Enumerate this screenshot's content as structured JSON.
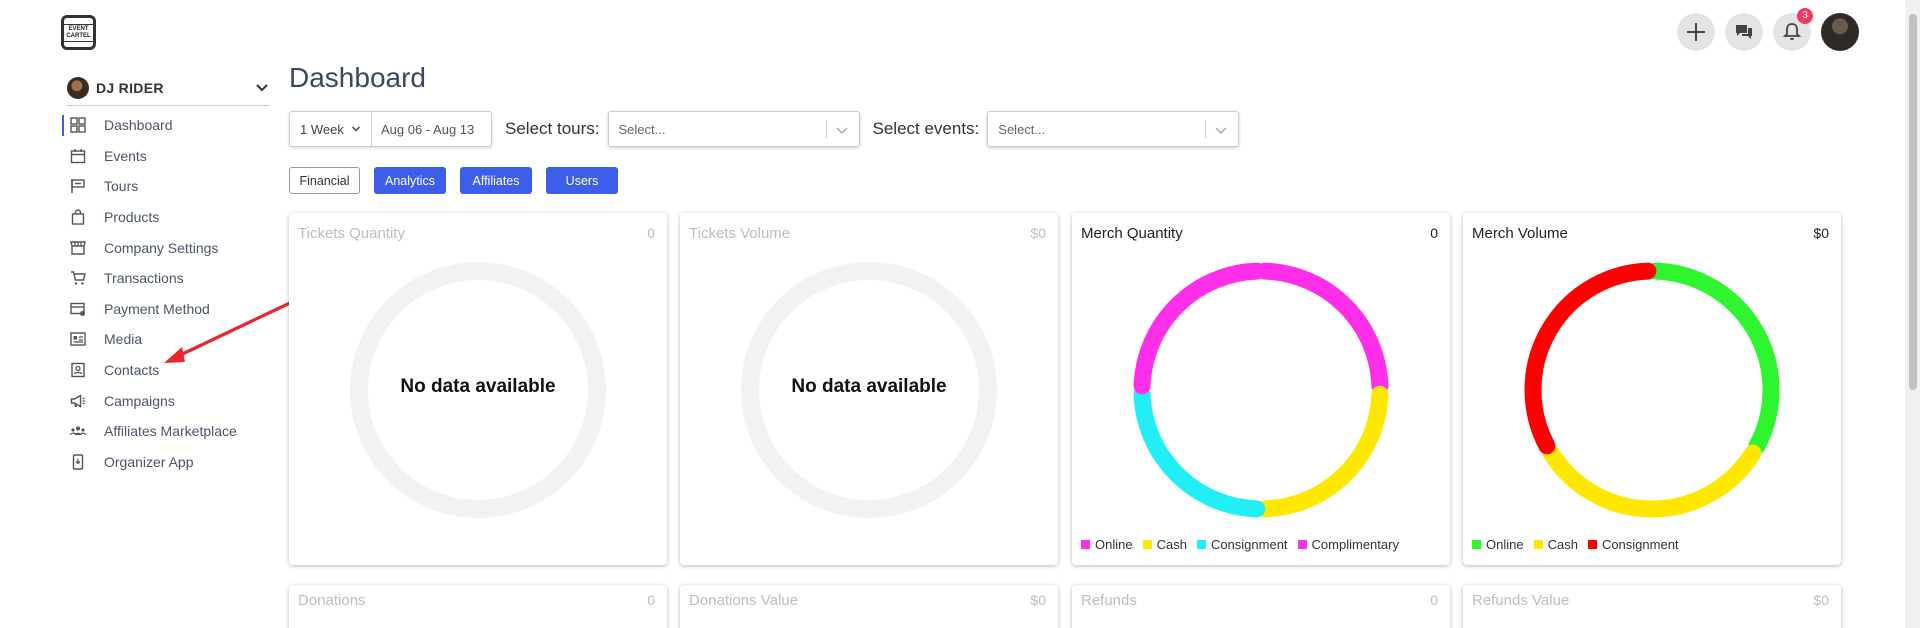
{
  "app": {
    "logo_text": "EVENT CARTEL"
  },
  "topbar": {
    "notifications_count": "3"
  },
  "account": {
    "name": "DJ RIDER"
  },
  "sidebar": {
    "items": [
      {
        "label": "Dashboard",
        "icon": "dashboard-icon",
        "active": true
      },
      {
        "label": "Events",
        "icon": "calendar-icon"
      },
      {
        "label": "Tours",
        "icon": "flag-icon"
      },
      {
        "label": "Products",
        "icon": "shopping-bag-icon"
      },
      {
        "label": "Company Settings",
        "icon": "store-icon"
      },
      {
        "label": "Transactions",
        "icon": "cart-icon"
      },
      {
        "label": "Payment Method",
        "icon": "card-settings-icon"
      },
      {
        "label": "Media",
        "icon": "media-icon"
      },
      {
        "label": "Contacts",
        "icon": "contacts-icon"
      },
      {
        "label": "Campaigns",
        "icon": "megaphone-icon"
      },
      {
        "label": "Affiliates Marketplace",
        "icon": "group-icon"
      },
      {
        "label": "Organizer App",
        "icon": "phone-icon"
      }
    ]
  },
  "main": {
    "title": "Dashboard",
    "filters": {
      "period": "1 Week",
      "date_range": "Aug 06 - Aug 13",
      "tours_label": "Select tours:",
      "tours_placeholder": "Select...",
      "events_label": "Select events:",
      "events_placeholder": "Select..."
    },
    "tabs": [
      "Financial",
      "Analytics",
      "Affiliates",
      "Users"
    ],
    "cards": [
      {
        "title": "Tickets Quantity",
        "value": "0",
        "message": "No data available"
      },
      {
        "title": "Tickets Volume",
        "value": "$0",
        "message": "No data available"
      },
      {
        "title": "Merch Quantity",
        "value": "0",
        "chart_data": {
          "type": "pie",
          "segments": [
            {
              "name": "Complimentary",
              "color": "#ff2ee8",
              "value": 0.25
            },
            {
              "name": "Cash",
              "color": "#ffe800",
              "value": 0.25
            },
            {
              "name": "Consignment",
              "color": "#22eef5",
              "value": 0.25
            },
            {
              "name": "Online",
              "color": "#ff2ee8",
              "value": 0.25
            }
          ],
          "legend": [
            {
              "name": "Online",
              "color": "#ff2ee8"
            },
            {
              "name": "Cash",
              "color": "#ffe800"
            },
            {
              "name": "Consignment",
              "color": "#22eef5"
            },
            {
              "name": "Complimentary",
              "color": "#ff2ee8"
            }
          ]
        }
      },
      {
        "title": "Merch Volume",
        "value": "$0",
        "chart_data": {
          "type": "pie",
          "segments": [
            {
              "name": "Online",
              "color": "#2ef52e",
              "value": 0.333
            },
            {
              "name": "Cash",
              "color": "#ffe800",
              "value": 0.333
            },
            {
              "name": "Consignment",
              "color": "#ff0000",
              "value": 0.333
            }
          ],
          "legend": [
            {
              "name": "Online",
              "color": "#2ef52e"
            },
            {
              "name": "Cash",
              "color": "#ffe800"
            },
            {
              "name": "Consignment",
              "color": "#ff0000"
            }
          ]
        }
      }
    ],
    "cards_row2": [
      {
        "title": "Donations",
        "value": "0"
      },
      {
        "title": "Donations Value",
        "value": "$0"
      },
      {
        "title": "Refunds",
        "value": "0"
      },
      {
        "title": "Refunds Value",
        "value": "$0"
      }
    ]
  },
  "colors": {
    "accent": "#3d5ee8",
    "title": "#3a4568"
  }
}
